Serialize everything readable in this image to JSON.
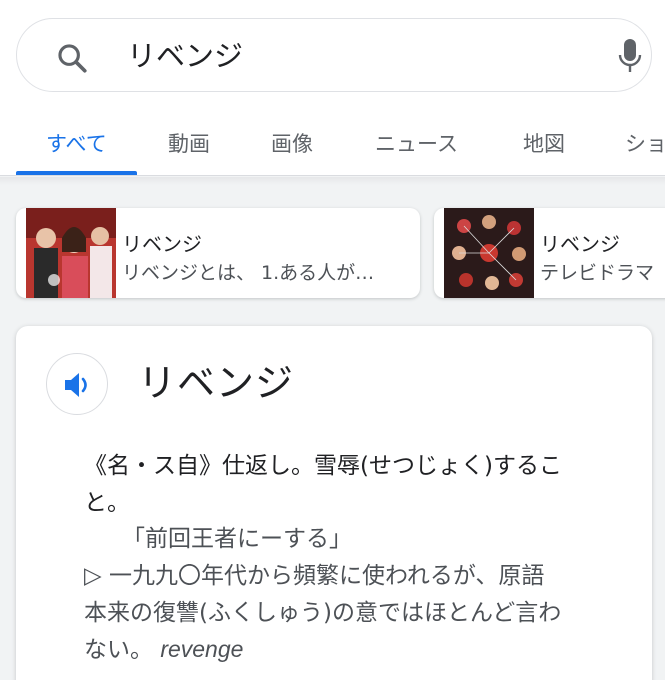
{
  "search": {
    "query": "リベンジ"
  },
  "tabs": [
    {
      "label": "すべて",
      "active": true
    },
    {
      "label": "動画"
    },
    {
      "label": "画像"
    },
    {
      "label": "ニュース"
    },
    {
      "label": "地図"
    },
    {
      "label": "ショ"
    }
  ],
  "chips": [
    {
      "title": "リベンジ",
      "description": "リベンジとは、 1.ある人が…"
    },
    {
      "title": "リベンジ",
      "description": "テレビドラマ"
    }
  ],
  "dictionary": {
    "headword": "リベンジ",
    "lines": [
      "《名・ス自》仕返し。雪辱(せつじょく)するこ",
      "と。",
      "「前回王者にーする」",
      "▷ 一九九〇年代から頻繁に使われるが、原語",
      "本来の復讐(ふくしゅう)の意ではほとんど言わ",
      "ない。"
    ],
    "english": "revenge"
  },
  "colors": {
    "accent": "#1a73e8",
    "text": "#202124",
    "muted": "#5f6368",
    "background": "#f1f3f4"
  },
  "icons": [
    "search-icon",
    "mic-icon",
    "speaker-icon"
  ]
}
